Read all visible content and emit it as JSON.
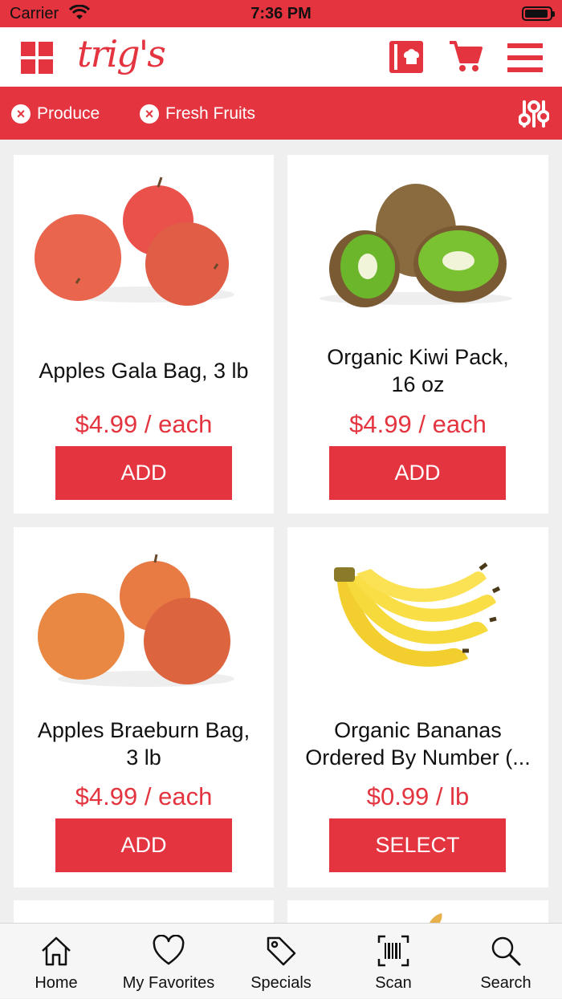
{
  "status_bar": {
    "carrier": "Carrier",
    "time": "7:36 PM"
  },
  "header": {
    "logo_text": "trig's",
    "icons": [
      "grid-icon",
      "recipe-icon",
      "cart-icon",
      "menu-icon"
    ]
  },
  "filters": {
    "chips": [
      {
        "label": "Produce"
      },
      {
        "label": "Fresh Fruits"
      }
    ],
    "settings_icon": "sliders-icon"
  },
  "products": [
    {
      "name_line1": "Apples Gala Bag, 3 lb",
      "name_line2": "",
      "price": "$4.99 / each",
      "button": "ADD",
      "image": "apples-gala-image"
    },
    {
      "name_line1": "Organic Kiwi Pack,",
      "name_line2": "16 oz",
      "price": "$4.99 / each",
      "button": "ADD",
      "image": "kiwi-image"
    },
    {
      "name_line1": "Apples Braeburn Bag,",
      "name_line2": "3 lb",
      "price": "$4.99 / each",
      "button": "ADD",
      "image": "apples-braeburn-image"
    },
    {
      "name_line1": "Organic Bananas",
      "name_line2": "Ordered By Number (...",
      "price": "$0.99 / lb",
      "button": "SELECT",
      "image": "bananas-image"
    }
  ],
  "tabs": [
    {
      "label": "Home",
      "icon": "home-icon"
    },
    {
      "label": "My Favorites",
      "icon": "heart-icon"
    },
    {
      "label": "Specials",
      "icon": "tag-icon"
    },
    {
      "label": "Scan",
      "icon": "barcode-icon"
    },
    {
      "label": "Search",
      "icon": "search-icon"
    }
  ],
  "colors": {
    "brand": "#e3343f",
    "background": "#efefef"
  }
}
